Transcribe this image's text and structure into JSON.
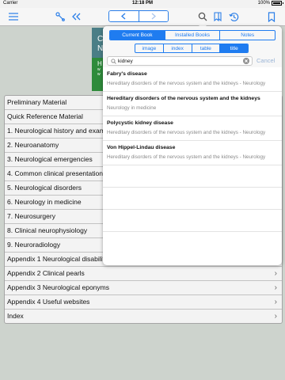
{
  "status_bar": {
    "carrier": "Carrier",
    "time": "12:18 PM",
    "battery": "100%"
  },
  "toolbar": {
    "icons": [
      "menu-icon",
      "fast-rewind-icon",
      "tools-icon",
      "double-chevron-left-icon",
      "back-arrow-icon",
      "forward-arrow-icon",
      "search-icon",
      "bookmarks-icon",
      "history-icon",
      "bookmark-icon"
    ]
  },
  "cover": {
    "teal_text": "C",
    "teal_text2": "N",
    "green_text": "H",
    "green_sub1": "w",
    "green_sub2": "w"
  },
  "toc": {
    "items": [
      {
        "label": "Preliminary Material",
        "chevron": false
      },
      {
        "label": "Quick Reference Material",
        "chevron": false
      },
      {
        "label": "1. Neurological history and exam",
        "chevron": false
      },
      {
        "label": "2. Neuroanatomy",
        "chevron": false
      },
      {
        "label": "3. Neurological emergencies",
        "chevron": false
      },
      {
        "label": "4. Common clinical presentations",
        "chevron": false
      },
      {
        "label": "5. Neurological disorders",
        "chevron": false
      },
      {
        "label": "6. Neurology in medicine",
        "chevron": false
      },
      {
        "label": "7. Neurosurgery",
        "chevron": false
      },
      {
        "label": "8. Clinical neurophysiology",
        "chevron": false
      },
      {
        "label": "9. Neuroradiology",
        "chevron": false
      },
      {
        "label": "Appendix 1 Neurological disability",
        "chevron": false
      },
      {
        "label": "Appendix 2 Clinical pearls",
        "chevron": true
      },
      {
        "label": "Appendix 3 Neurological eponyms",
        "chevron": true
      },
      {
        "label": "Appendix 4 Useful websites",
        "chevron": true
      },
      {
        "label": "Index",
        "chevron": true
      }
    ],
    "chevron_glyph": "›"
  },
  "search_popover": {
    "scope_tabs": [
      {
        "label": "Current Book",
        "active": true
      },
      {
        "label": "Installed Books",
        "active": false
      },
      {
        "label": "Notes",
        "active": false
      }
    ],
    "type_tabs": [
      {
        "label": "image",
        "active": false
      },
      {
        "label": "index",
        "active": false
      },
      {
        "label": "table",
        "active": false
      },
      {
        "label": "title",
        "active": true
      }
    ],
    "query": "kidney",
    "cancel_label": "Cancel",
    "results": [
      {
        "title": "Fabry's disease",
        "subtitle": "Hereditary disorders of the nervous system and the kidneys - Neurology"
      },
      {
        "title": "Hereditary disorders of the nervous system and the kidneys",
        "subtitle": "Neurology in medicine"
      },
      {
        "title": "Polycystic kidney disease",
        "subtitle": "Hereditary disorders of the nervous system and the kidneys - Neurology"
      },
      {
        "title": "Von Hippel-Lindau disease",
        "subtitle": "Hereditary disorders of the nervous system and the kidneys - Neurology"
      }
    ],
    "empty_rows": 3
  },
  "colors": {
    "accent": "#1f7cf0",
    "toolbar_icon": "#2a7ee8",
    "cover_teal": "#4a7e86",
    "cover_green": "#2e8b3b"
  }
}
